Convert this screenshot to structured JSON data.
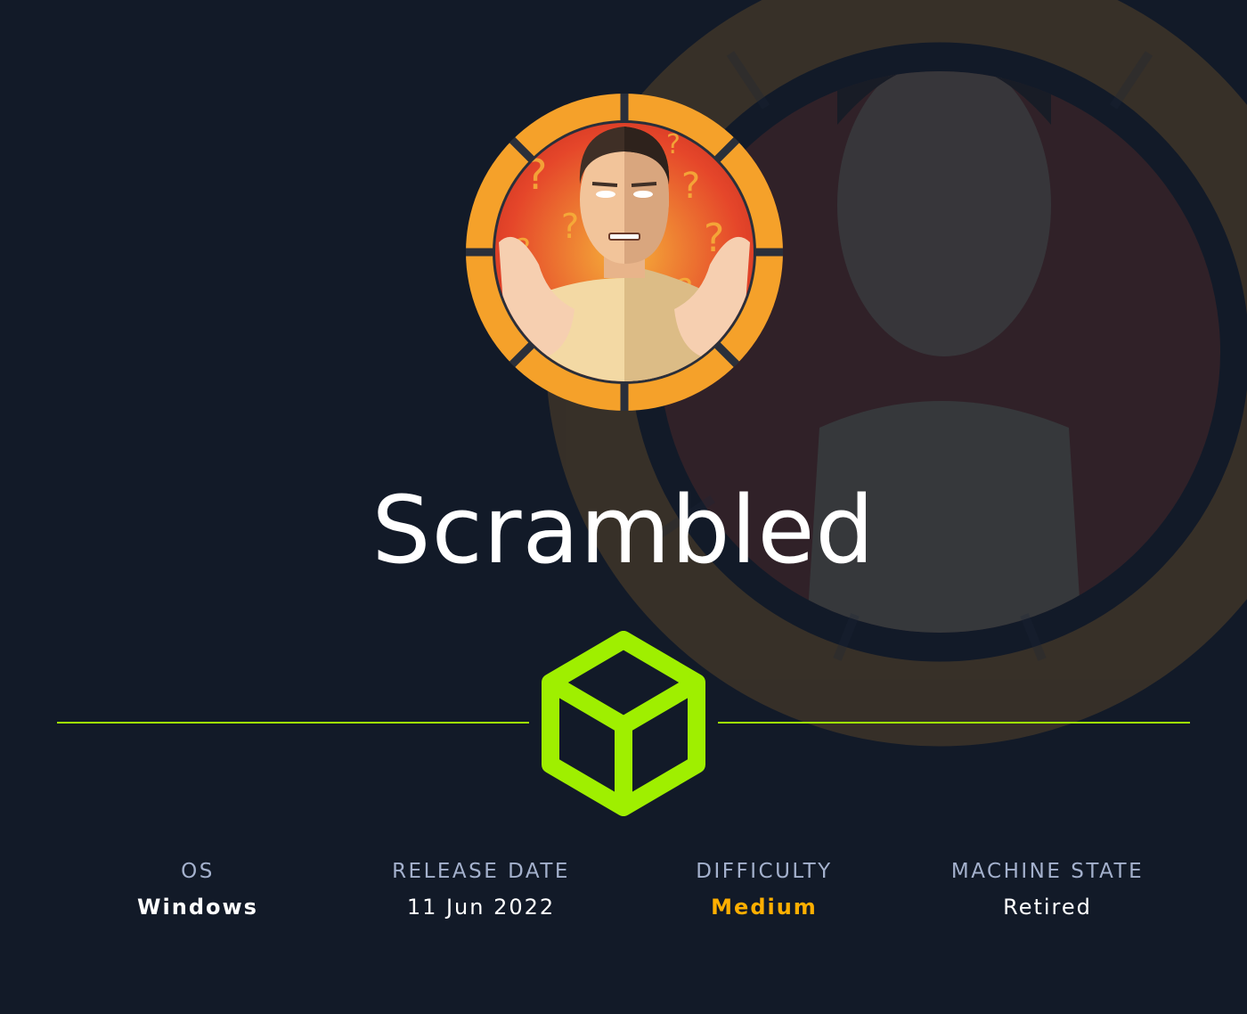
{
  "machine": {
    "name": "Scrambled"
  },
  "stats": [
    {
      "label": "OS",
      "value": "Windows"
    },
    {
      "label": "RELEASE DATE",
      "value": "11 Jun 2022"
    },
    {
      "label": "DIFFICULTY",
      "value": "Medium"
    },
    {
      "label": "MACHINE STATE",
      "value": "Retired"
    }
  ],
  "colors": {
    "background": "#121a28",
    "accent_green": "#9fef00",
    "medium_orange": "#ffaf00",
    "label_gray": "#a4b1cd",
    "ring_orange": "#f5a12a"
  },
  "icons": {
    "logo": "cube-icon",
    "avatar": "shrugging-man-avatar"
  }
}
